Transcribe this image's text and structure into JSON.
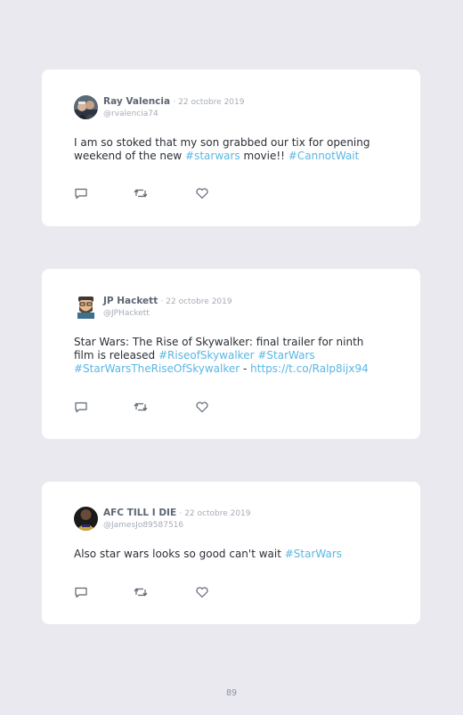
{
  "tweets": [
    {
      "name": "Ray Valencia",
      "date": "· 22 octobre 2019",
      "handle": "@rvalencia74",
      "body": [
        {
          "text": "I am so stoked that my son grabbed our tix for opening weekend of the new ",
          "link": false
        },
        {
          "text": "#starwars",
          "link": true
        },
        {
          "text": " movie!! ",
          "link": false
        },
        {
          "text": "#CannotWait",
          "link": true
        }
      ],
      "avatar_icon": "profile-photo-two-people"
    },
    {
      "name": "JP Hackett",
      "date": "· 22 octobre 2019",
      "handle": "@JPHackett",
      "body": [
        {
          "text": "Star Wars: The Rise of Skywalker: final trailer for ninth film is released ",
          "link": false
        },
        {
          "text": "#RiseofSkywalker",
          "link": true
        },
        {
          "text": " ",
          "link": false
        },
        {
          "text": "#StarWars",
          "link": true
        },
        {
          "text": " ",
          "link": false
        },
        {
          "text": "#StarWarsTheRiseOfSkywalker",
          "link": true
        },
        {
          "text": " - ",
          "link": false
        },
        {
          "text": "https://t.co/Ralp8ijx94",
          "link": true
        }
      ],
      "avatar_icon": "cartoon-bearded-man-avatar"
    },
    {
      "name": "AFC TILL I DIE",
      "date": "· 22 octobre 2019",
      "handle": "@JamesJo89587516",
      "body": [
        {
          "text": "Also star wars looks so good can't wait ",
          "link": false
        },
        {
          "text": "#StarWars",
          "link": true
        }
      ],
      "avatar_icon": "afc-shirt-avatar"
    }
  ],
  "actions": [
    "reply-icon",
    "retweet-icon",
    "like-icon"
  ],
  "page_number": "89",
  "colors": {
    "background": "#e9e9ef",
    "card": "#ffffff",
    "link": "#5bb6e3",
    "name": "#5e6672",
    "muted": "#a6adb6"
  }
}
